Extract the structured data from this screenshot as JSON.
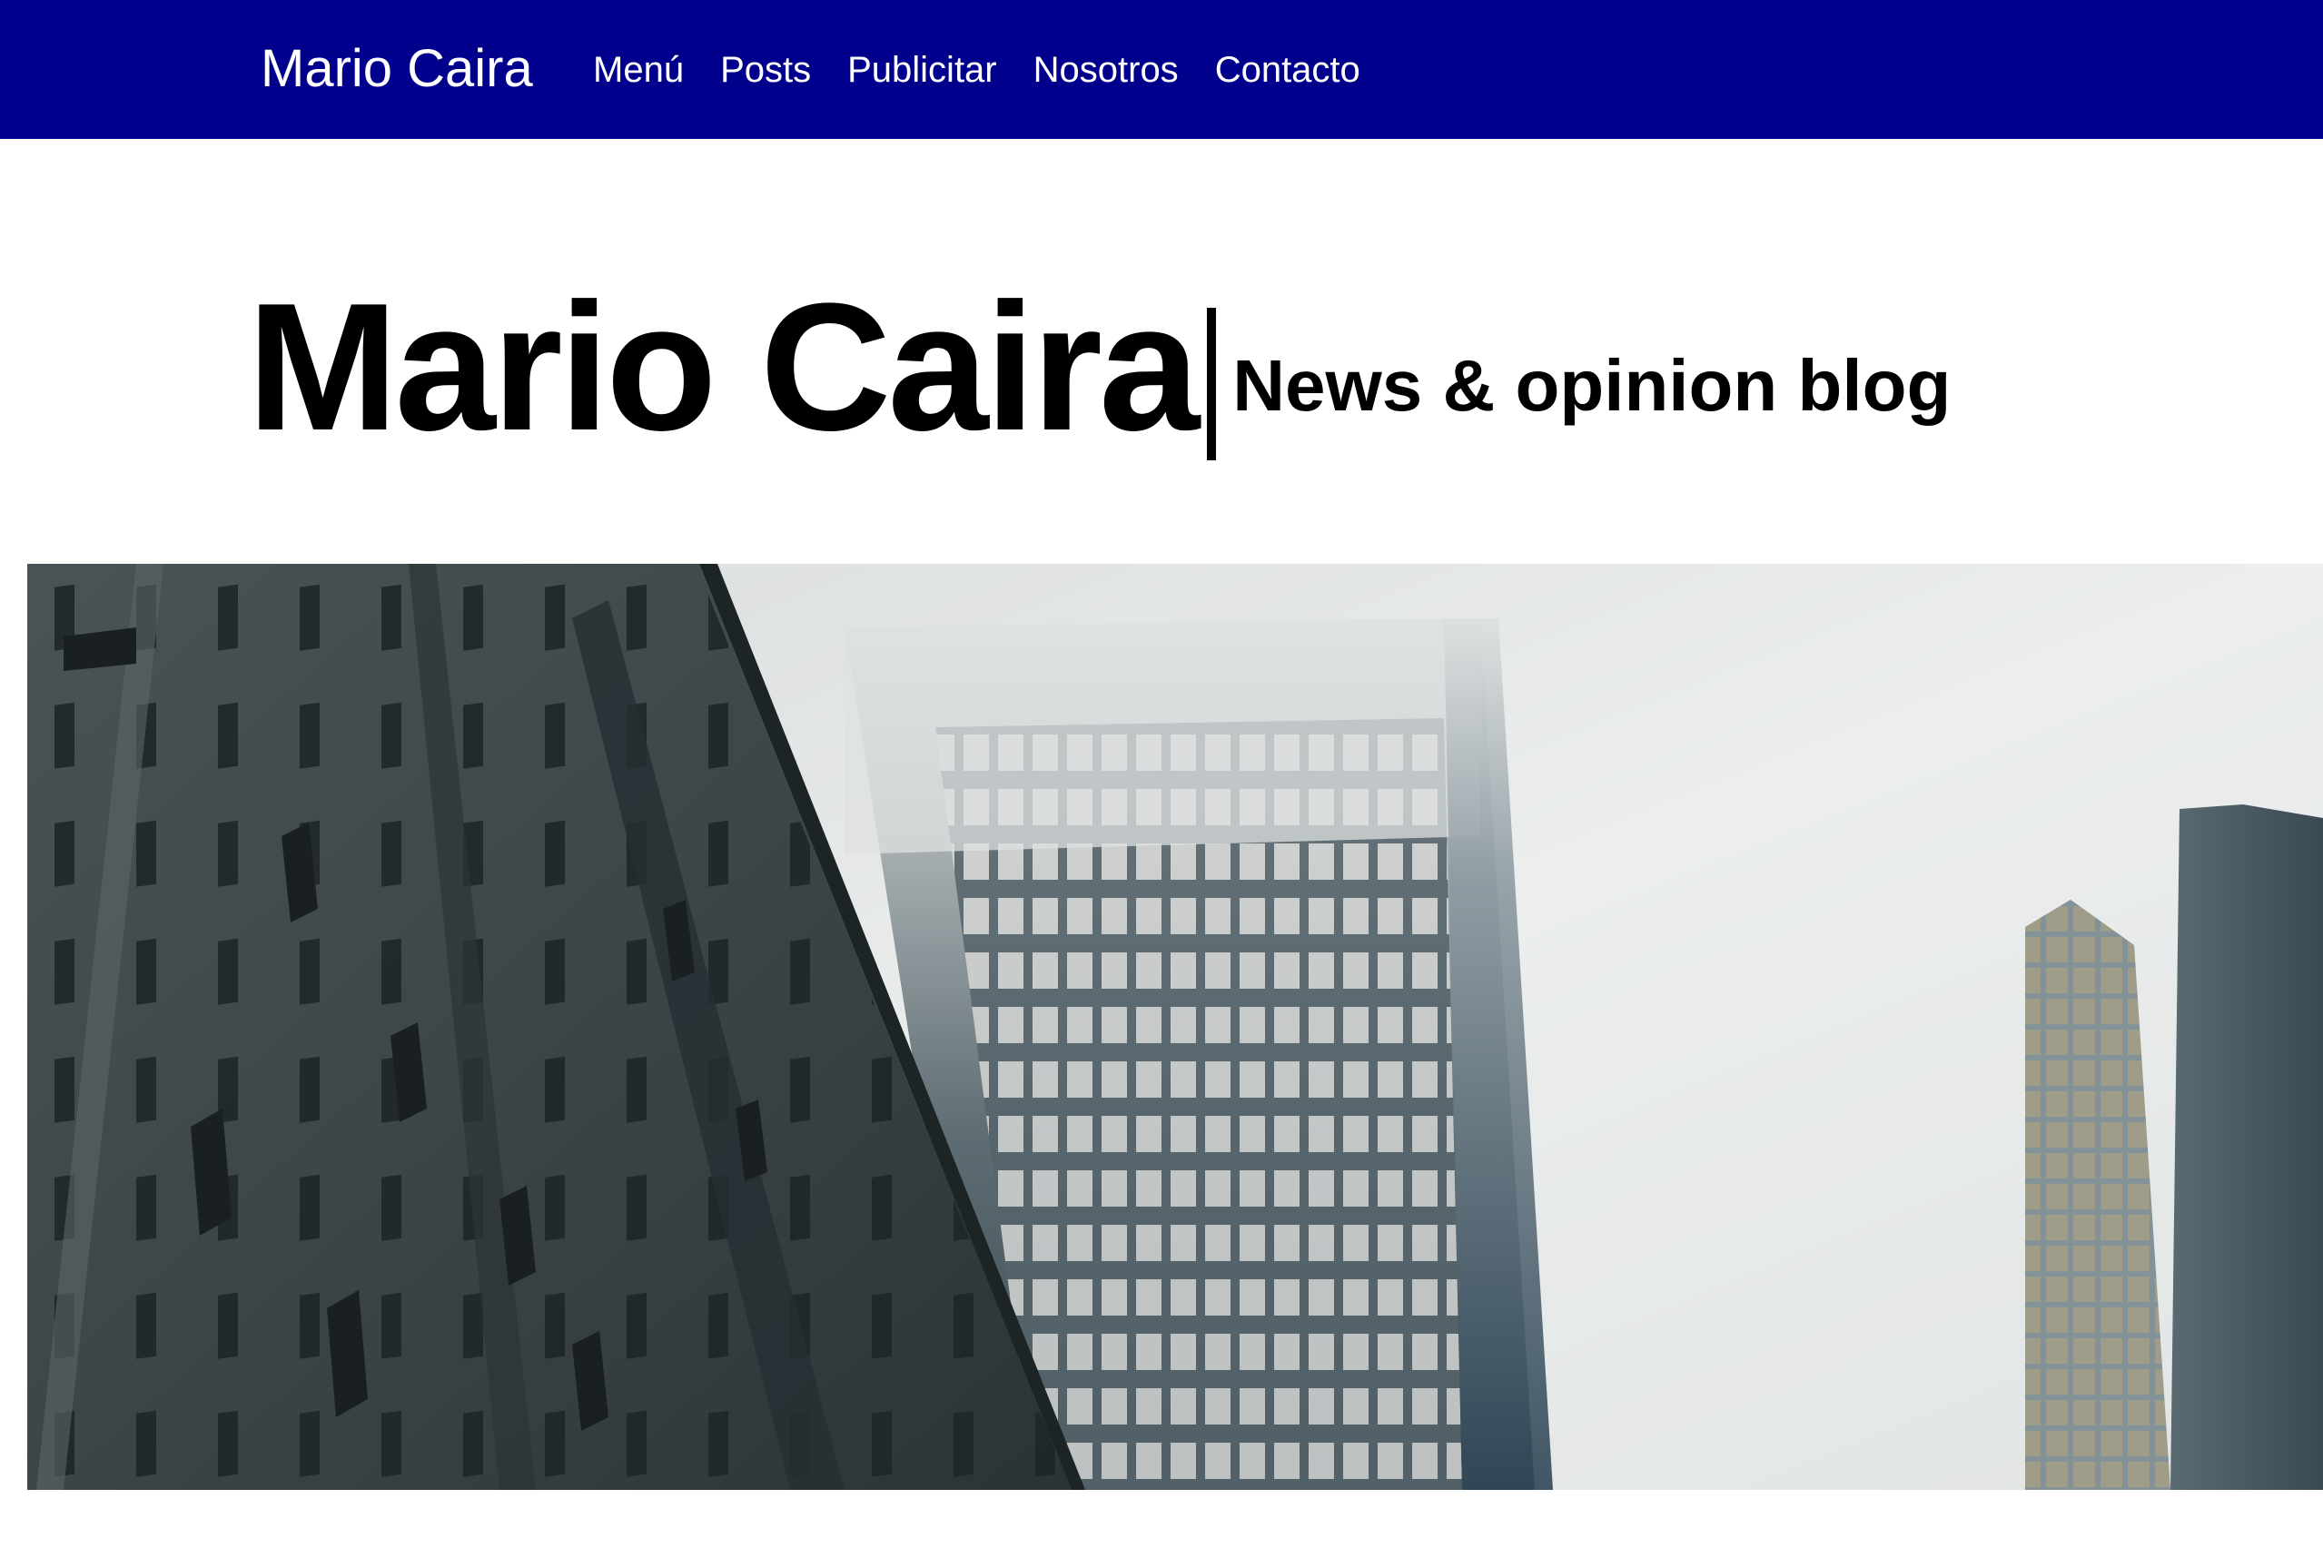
{
  "nav": {
    "brand": "Mario Caira",
    "links": [
      "Menú",
      "Posts",
      "Publicitar",
      "Nosotros",
      "Contacto"
    ]
  },
  "masthead": {
    "title": "Mario Caira",
    "tagline": "News & opinion blog"
  },
  "hero": {
    "subject": "foggy-skyscrapers-photo"
  },
  "colors": {
    "navbar_bg": "#01008d",
    "nav_text": "#ffffff",
    "title_text": "#000000",
    "page_bg": "#ffffff"
  }
}
